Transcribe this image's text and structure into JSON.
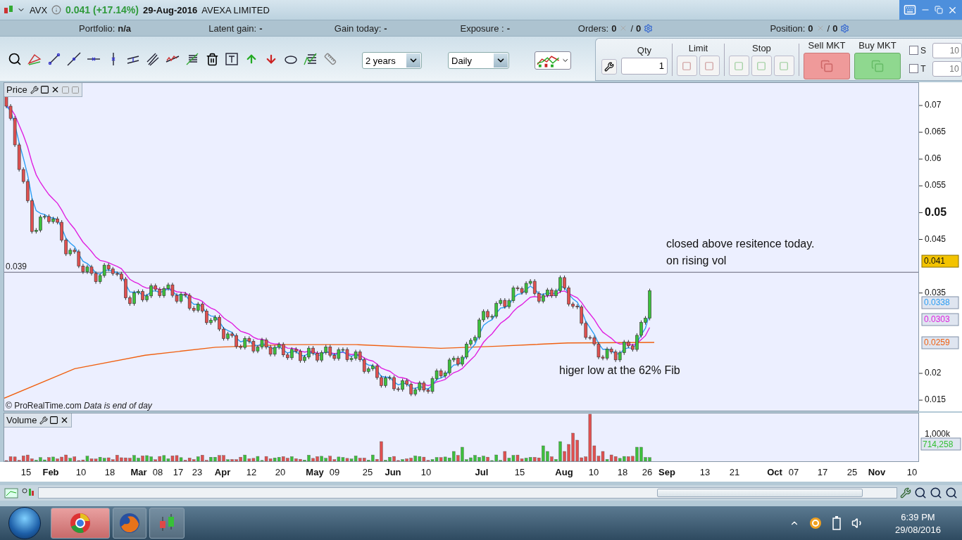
{
  "header": {
    "symbol": "AVX",
    "quote": "0.041 (+17.14%)",
    "date": "29-Aug-2016",
    "company": "AVEXA LIMITED"
  },
  "summary": [
    {
      "label": "Portfolio:",
      "value": "n/a"
    },
    {
      "label": "Latent gain:",
      "value": "-"
    },
    {
      "label": "Gain today:",
      "value": "-"
    },
    {
      "label": "Exposure :",
      "value": "-"
    }
  ],
  "counters": [
    {
      "label": "Orders:",
      "count": "0",
      "separator": "/",
      "pending": "0"
    },
    {
      "label": "Position:",
      "count": "0",
      "separator": "/",
      "pending": "0"
    }
  ],
  "toolbar": {
    "period": "2 years",
    "interval": "Daily"
  },
  "order_panel": {
    "qty_label": "Qty",
    "qty": "1",
    "limit_label": "Limit",
    "stop_label": "Stop",
    "sell": "Sell MKT",
    "buy": "Buy MKT",
    "stops": [
      {
        "label": "S",
        "checked": false,
        "placeholder": "10"
      },
      {
        "label": "T",
        "checked": false,
        "placeholder": "10"
      }
    ]
  },
  "price_panel": {
    "title": "Price",
    "level_label": "0.039",
    "y_ticks": [
      {
        "label": "0.07",
        "bold": false
      },
      {
        "label": "0.065",
        "bold": false
      },
      {
        "label": "0.06",
        "bold": false
      },
      {
        "label": "0.055",
        "bold": false
      },
      {
        "label": "0.05",
        "bold": true
      },
      {
        "label": "0.045",
        "bold": false
      },
      {
        "label": "0.035",
        "bold": false
      },
      {
        "label": "0.02",
        "bold": false
      },
      {
        "label": "0.015",
        "bold": false
      }
    ],
    "tags": [
      {
        "text": "0.041",
        "kind": "last"
      },
      {
        "text": "0.0338",
        "kind": "indicator",
        "color": "#2a9df4"
      },
      {
        "text": "0.0303",
        "kind": "indicator",
        "color": "#e020e0"
      },
      {
        "text": "0.0259",
        "kind": "indicator",
        "color": "#f06010"
      }
    ],
    "notes": [
      {
        "lines": [
          "closed above resitence today.",
          "on rising vol"
        ]
      },
      {
        "lines": [
          "higer low at the 62% Fib"
        ]
      }
    ],
    "credit": "© ProRealTime.com *Data is end of day*"
  },
  "volume_panel": {
    "title": "Volume",
    "y_tick": "1,000k",
    "tag": {
      "text": "714,258",
      "color": "#33c033"
    }
  },
  "x_axis": [
    {
      "label": "15",
      "kind": "day"
    },
    {
      "label": "Feb",
      "kind": "month"
    },
    {
      "label": "10",
      "kind": "day"
    },
    {
      "label": "18",
      "kind": "day"
    },
    {
      "label": "Mar",
      "kind": "month"
    },
    {
      "label": "08",
      "kind": "day"
    },
    {
      "label": "17",
      "kind": "day"
    },
    {
      "label": "23",
      "kind": "day"
    },
    {
      "label": "Apr",
      "kind": "month"
    },
    {
      "label": "12",
      "kind": "day"
    },
    {
      "label": "20",
      "kind": "day"
    },
    {
      "label": "May",
      "kind": "month"
    },
    {
      "label": "09",
      "kind": "day"
    },
    {
      "label": "25",
      "kind": "day"
    },
    {
      "label": "Jun",
      "kind": "month"
    },
    {
      "label": "10",
      "kind": "day"
    },
    {
      "label": "Jul",
      "kind": "month"
    },
    {
      "label": "15",
      "kind": "day"
    },
    {
      "label": "Aug",
      "kind": "month"
    },
    {
      "label": "10",
      "kind": "day"
    },
    {
      "label": "18",
      "kind": "day"
    },
    {
      "label": "26",
      "kind": "day"
    },
    {
      "label": "Sep",
      "kind": "month"
    },
    {
      "label": "13",
      "kind": "day"
    },
    {
      "label": "21",
      "kind": "day"
    },
    {
      "label": "Oct",
      "kind": "month"
    },
    {
      "label": "07",
      "kind": "day"
    },
    {
      "label": "17",
      "kind": "day"
    },
    {
      "label": "25",
      "kind": "day"
    },
    {
      "label": "Nov",
      "kind": "month"
    },
    {
      "label": "10",
      "kind": "day"
    }
  ],
  "taskbar": {
    "apps": [
      {
        "kind": "browser-round",
        "selected": true
      },
      {
        "kind": "browser-fox",
        "selected": false
      },
      {
        "kind": "chart",
        "selected": false
      }
    ],
    "clock": "6:39 PM",
    "date": "29/08/2016"
  }
}
